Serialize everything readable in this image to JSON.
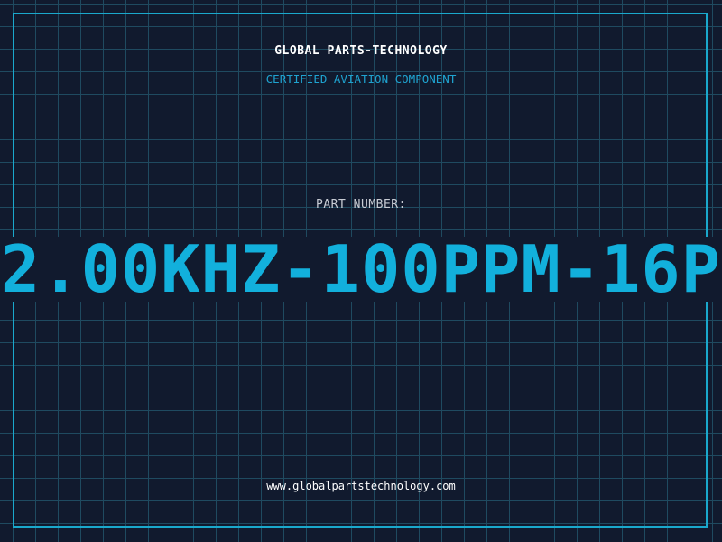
{
  "header": {
    "brand": "GLOBAL PARTS-TECHNOLOGY",
    "subtitle": "CERTIFIED AVIATION COMPONENT"
  },
  "part": {
    "label": "PART NUMBER:",
    "value": "2.00KHZ-100PPM-16P"
  },
  "footer": {
    "website": "www.globalpartstechnology.com"
  },
  "colors": {
    "background": "#111a2e",
    "grid": "#1f4a60",
    "frame": "#1aa8cc",
    "accent": "#12b0dc",
    "brand_text": "#ffffff",
    "label_text": "#c8ccd4"
  }
}
